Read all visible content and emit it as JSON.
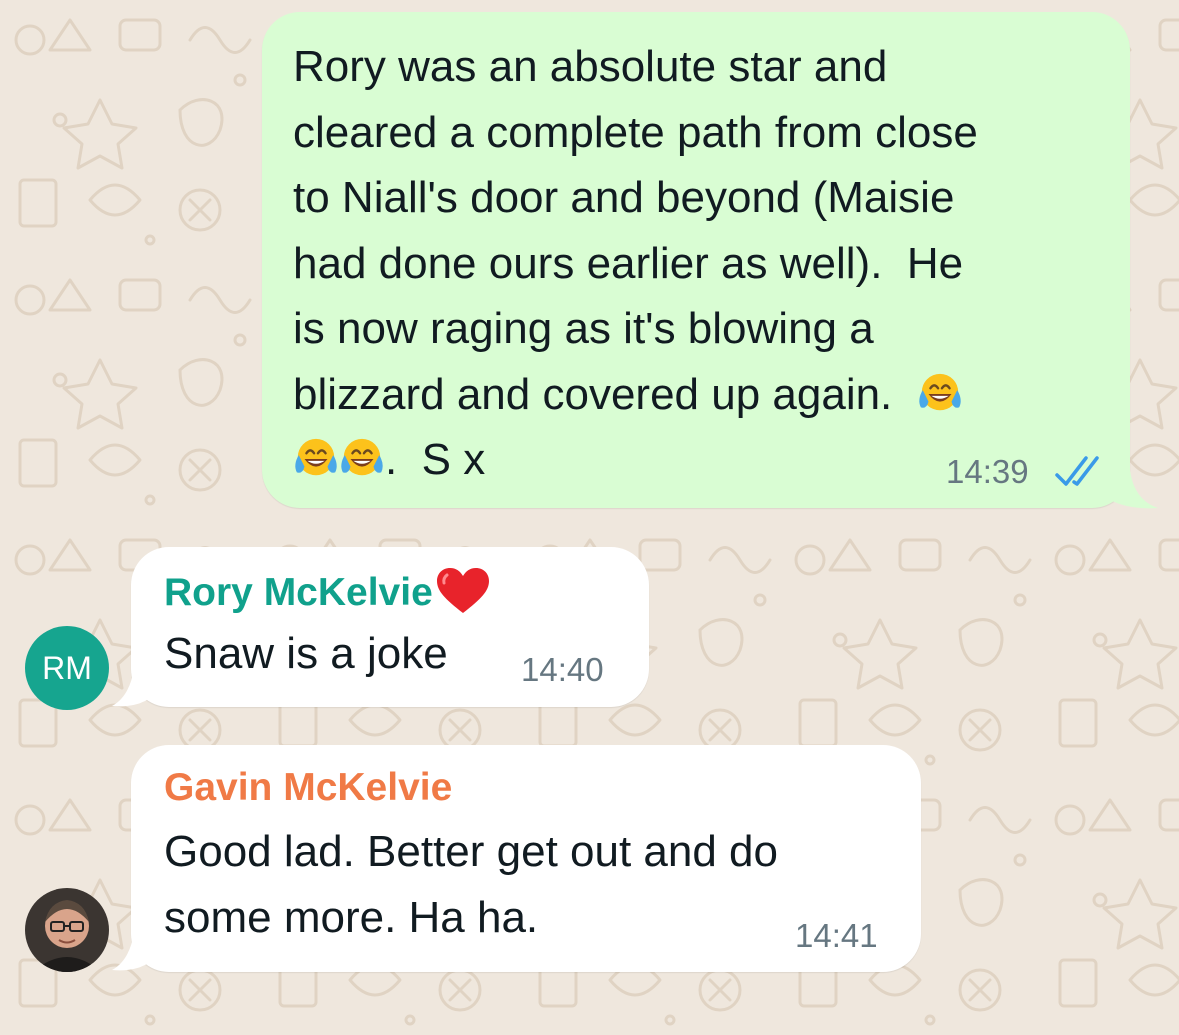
{
  "colors": {
    "wallpaper": "#efe7dd",
    "outgoing_bubble": "#d9fdd3",
    "incoming_bubble": "#ffffff",
    "read_ticks": "#3a9ae8",
    "sender_rory": "#10a18c",
    "sender_gavin": "#f07a46",
    "avatar_rm": "#16a58f"
  },
  "messages": [
    {
      "direction": "outgoing",
      "lines": [
        "Rory was an absolute star and",
        "cleared a complete path from close",
        "to Niall's door and beyond (Maisie",
        "had done ours earlier as well).  He",
        "is now raging as it's blowing a",
        "blizzard and covered up again."
      ],
      "last_line_text": ".  S x",
      "emoji": "face-with-tears-of-joy",
      "time": "14:39",
      "status_icon": "double-check-read-icon"
    },
    {
      "direction": "incoming",
      "sender": "Rory McKelvie",
      "sender_emoji": "red-heart",
      "avatar_initials": "RM",
      "text": "Snaw is a joke",
      "time": "14:40"
    },
    {
      "direction": "incoming",
      "sender": "Gavin McKelvie",
      "avatar": "profile-photo",
      "lines": [
        "Good lad. Better get out and do",
        "some more. Ha ha."
      ],
      "time": "14:41"
    }
  ]
}
